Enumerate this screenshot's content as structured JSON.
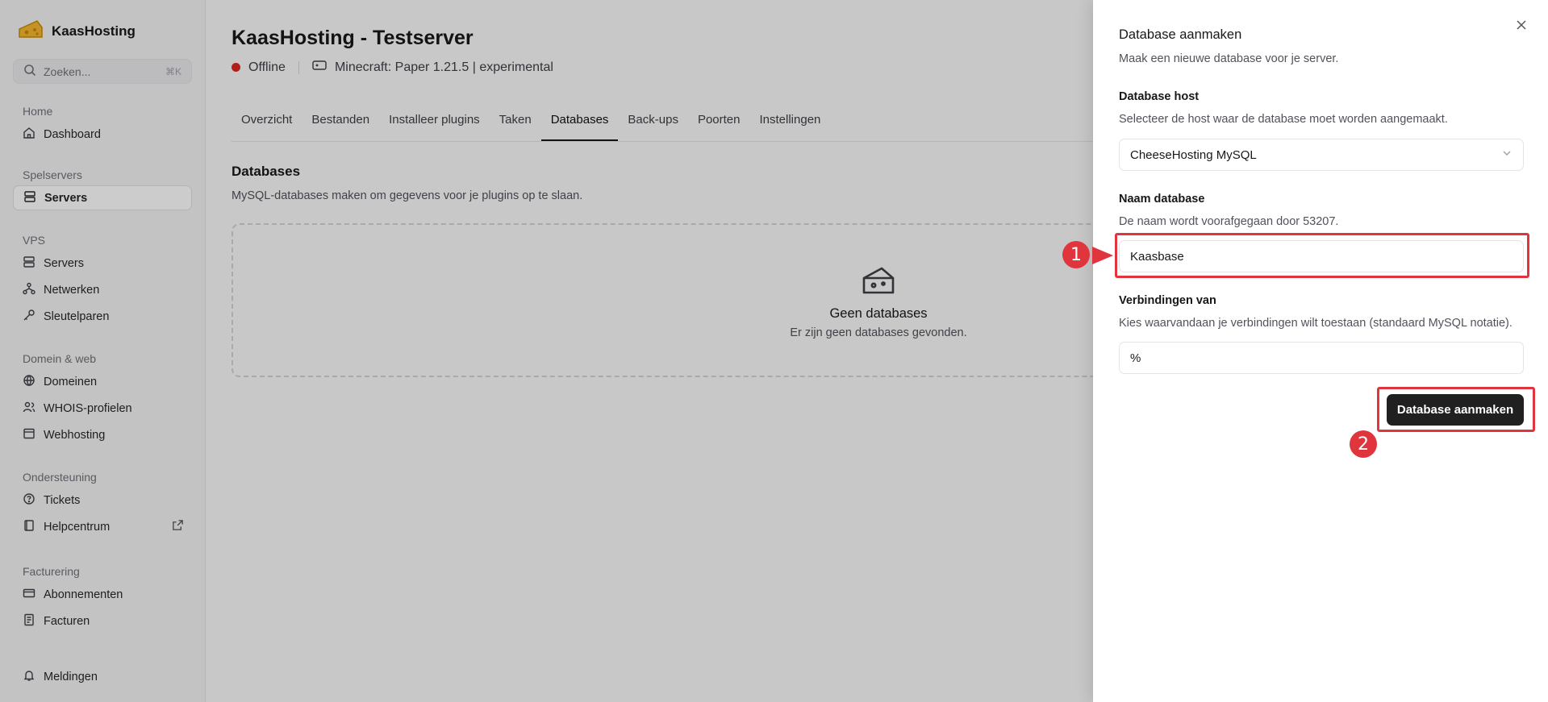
{
  "sidebar": {
    "brand": "KaasHosting",
    "search_placeholder": "Zoeken...",
    "search_shortcut": "⌘K",
    "groups": [
      {
        "heading": "Home",
        "items": [
          {
            "label": "Dashboard",
            "icon": "home-icon"
          }
        ]
      },
      {
        "heading": "Spelservers",
        "items": [
          {
            "label": "Servers",
            "icon": "server-icon",
            "active": true
          }
        ]
      },
      {
        "heading": "VPS",
        "items": [
          {
            "label": "Servers",
            "icon": "server-icon"
          },
          {
            "label": "Netwerken",
            "icon": "network-icon"
          },
          {
            "label": "Sleutelparen",
            "icon": "key-icon"
          }
        ]
      },
      {
        "heading": "Domein & web",
        "items": [
          {
            "label": "Domeinen",
            "icon": "globe-icon"
          },
          {
            "label": "WHOIS-profielen",
            "icon": "users-icon"
          },
          {
            "label": "Webhosting",
            "icon": "browser-icon"
          }
        ]
      },
      {
        "heading": "Ondersteuning",
        "items": [
          {
            "label": "Tickets",
            "icon": "ticket-icon"
          },
          {
            "label": "Helpcentrum",
            "icon": "book-icon",
            "external": true
          }
        ]
      },
      {
        "heading": "Facturering",
        "items": [
          {
            "label": "Abonnementen",
            "icon": "credit-card-icon"
          },
          {
            "label": "Facturen",
            "icon": "invoice-icon"
          }
        ]
      }
    ],
    "notifications": "Meldingen"
  },
  "main": {
    "title": "KaasHosting - Testserver",
    "status": "Offline",
    "status_color": "#dc2626",
    "server_type": "Minecraft: Paper 1.21.5 | experimental",
    "tabs": [
      "Overzicht",
      "Bestanden",
      "Installeer plugins",
      "Taken",
      "Databases",
      "Back-ups",
      "Poorten",
      "Instellingen"
    ],
    "active_tab": "Databases",
    "section_title": "Databases",
    "section_desc": "MySQL-databases maken om gegevens voor je plugins op te slaan.",
    "empty_title": "Geen databases",
    "empty_desc": "Er zijn geen databases gevonden."
  },
  "drawer": {
    "title": "Database aanmaken",
    "subtitle": "Maak een nieuwe database voor je server.",
    "host_label": "Database host",
    "host_hint": "Selecteer de host waar de database moet worden aangemaakt.",
    "host_value": "CheeseHosting MySQL",
    "name_label": "Naam database",
    "name_hint": "De naam wordt voorafgegaan door 53207.",
    "name_value": "Kaasbase",
    "conn_label": "Verbindingen van",
    "conn_hint": "Kies waarvandaan je verbindingen wilt toestaan (standaard MySQL notatie).",
    "conn_value": "%",
    "submit_label": "Database aanmaken"
  },
  "annotations": {
    "step1": "1",
    "step2": "2",
    "color": "#e0353d"
  }
}
